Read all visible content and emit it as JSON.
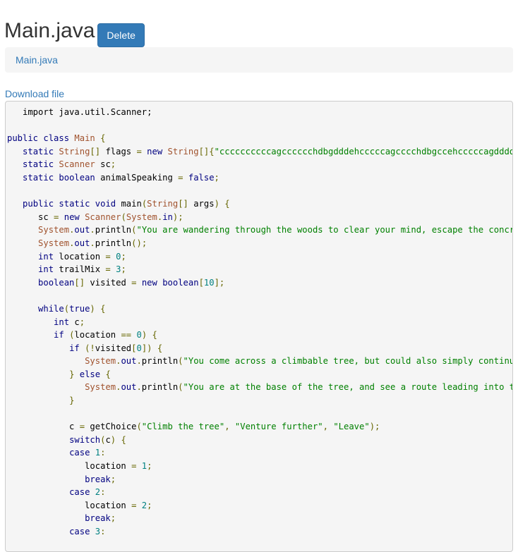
{
  "header": {
    "title": "Main.java",
    "delete_label": "Delete"
  },
  "breadcrumb": {
    "item": "Main.java"
  },
  "download": {
    "label": "Download file"
  },
  "code": {
    "lines": [
      [
        [
          "pl",
          "   import java.util.Scanner;"
        ]
      ],
      [],
      [
        [
          "kw",
          "public"
        ],
        [
          "pl",
          " "
        ],
        [
          "kw",
          "class"
        ],
        [
          "pl",
          " "
        ],
        [
          "ty",
          "Main"
        ],
        [
          "pl",
          " "
        ],
        [
          "op",
          "{"
        ]
      ],
      [
        [
          "pl",
          "   "
        ],
        [
          "kw",
          "static"
        ],
        [
          "pl",
          " "
        ],
        [
          "ty",
          "String"
        ],
        [
          "op",
          "[]"
        ],
        [
          "pl",
          " flags "
        ],
        [
          "op",
          "="
        ],
        [
          "pl",
          " "
        ],
        [
          "kw",
          "new"
        ],
        [
          "pl",
          " "
        ],
        [
          "ty",
          "String"
        ],
        [
          "op",
          "[]{"
        ],
        [
          "str",
          "\"ccccccccccagcccccchdbgdddehcccccagcccchdbgccehcccccagddddhdddd"
        ]
      ],
      [
        [
          "pl",
          "   "
        ],
        [
          "kw",
          "static"
        ],
        [
          "pl",
          " "
        ],
        [
          "ty",
          "Scanner"
        ],
        [
          "pl",
          " sc"
        ],
        [
          "op",
          ";"
        ]
      ],
      [
        [
          "pl",
          "   "
        ],
        [
          "kw",
          "static"
        ],
        [
          "pl",
          " "
        ],
        [
          "kw",
          "boolean"
        ],
        [
          "pl",
          " animalSpeaking "
        ],
        [
          "op",
          "="
        ],
        [
          "pl",
          " "
        ],
        [
          "kw",
          "false"
        ],
        [
          "op",
          ";"
        ]
      ],
      [],
      [
        [
          "pl",
          "   "
        ],
        [
          "kw",
          "public"
        ],
        [
          "pl",
          " "
        ],
        [
          "kw",
          "static"
        ],
        [
          "pl",
          " "
        ],
        [
          "kw",
          "void"
        ],
        [
          "pl",
          " main"
        ],
        [
          "op",
          "("
        ],
        [
          "ty",
          "String"
        ],
        [
          "op",
          "[]"
        ],
        [
          "pl",
          " args"
        ],
        [
          "op",
          ")"
        ],
        [
          "pl",
          " "
        ],
        [
          "op",
          "{"
        ]
      ],
      [
        [
          "pl",
          "      sc "
        ],
        [
          "op",
          "="
        ],
        [
          "pl",
          " "
        ],
        [
          "kw",
          "new"
        ],
        [
          "pl",
          " "
        ],
        [
          "ty",
          "Scanner"
        ],
        [
          "op",
          "("
        ],
        [
          "ty",
          "System"
        ],
        [
          "op",
          "."
        ],
        [
          "kw",
          "in"
        ],
        [
          "op",
          ");"
        ]
      ],
      [
        [
          "pl",
          "      "
        ],
        [
          "ty",
          "System"
        ],
        [
          "op",
          "."
        ],
        [
          "kw",
          "out"
        ],
        [
          "op",
          "."
        ],
        [
          "pl",
          "println"
        ],
        [
          "op",
          "("
        ],
        [
          "str",
          "\"You are wandering through the woods to clear your mind, escape the concrete"
        ]
      ],
      [
        [
          "pl",
          "      "
        ],
        [
          "ty",
          "System"
        ],
        [
          "op",
          "."
        ],
        [
          "kw",
          "out"
        ],
        [
          "op",
          "."
        ],
        [
          "pl",
          "println"
        ],
        [
          "op",
          "();"
        ]
      ],
      [
        [
          "pl",
          "      "
        ],
        [
          "kw",
          "int"
        ],
        [
          "pl",
          " location "
        ],
        [
          "op",
          "="
        ],
        [
          "pl",
          " "
        ],
        [
          "num",
          "0"
        ],
        [
          "op",
          ";"
        ]
      ],
      [
        [
          "pl",
          "      "
        ],
        [
          "kw",
          "int"
        ],
        [
          "pl",
          " trailMix "
        ],
        [
          "op",
          "="
        ],
        [
          "pl",
          " "
        ],
        [
          "num",
          "3"
        ],
        [
          "op",
          ";"
        ]
      ],
      [
        [
          "pl",
          "      "
        ],
        [
          "kw",
          "boolean"
        ],
        [
          "op",
          "[]"
        ],
        [
          "pl",
          " visited "
        ],
        [
          "op",
          "="
        ],
        [
          "pl",
          " "
        ],
        [
          "kw",
          "new"
        ],
        [
          "pl",
          " "
        ],
        [
          "kw",
          "boolean"
        ],
        [
          "op",
          "["
        ],
        [
          "num",
          "10"
        ],
        [
          "op",
          "];"
        ]
      ],
      [],
      [
        [
          "pl",
          "      "
        ],
        [
          "kw",
          "while"
        ],
        [
          "op",
          "("
        ],
        [
          "kw",
          "true"
        ],
        [
          "op",
          ")"
        ],
        [
          "pl",
          " "
        ],
        [
          "op",
          "{"
        ]
      ],
      [
        [
          "pl",
          "         "
        ],
        [
          "kw",
          "int"
        ],
        [
          "pl",
          " c"
        ],
        [
          "op",
          ";"
        ]
      ],
      [
        [
          "pl",
          "         "
        ],
        [
          "kw",
          "if"
        ],
        [
          "pl",
          " "
        ],
        [
          "op",
          "("
        ],
        [
          "pl",
          "location "
        ],
        [
          "op",
          "=="
        ],
        [
          "pl",
          " "
        ],
        [
          "num",
          "0"
        ],
        [
          "op",
          ")"
        ],
        [
          "pl",
          " "
        ],
        [
          "op",
          "{"
        ]
      ],
      [
        [
          "pl",
          "            "
        ],
        [
          "kw",
          "if"
        ],
        [
          "pl",
          " "
        ],
        [
          "op",
          "(!"
        ],
        [
          "pl",
          "visited"
        ],
        [
          "op",
          "["
        ],
        [
          "num",
          "0"
        ],
        [
          "op",
          "])"
        ],
        [
          "pl",
          " "
        ],
        [
          "op",
          "{"
        ]
      ],
      [
        [
          "pl",
          "               "
        ],
        [
          "ty",
          "System"
        ],
        [
          "op",
          "."
        ],
        [
          "kw",
          "out"
        ],
        [
          "op",
          "."
        ],
        [
          "pl",
          "println"
        ],
        [
          "op",
          "("
        ],
        [
          "str",
          "\"You come across a climbable tree, but could also simply continue f"
        ]
      ],
      [
        [
          "pl",
          "            "
        ],
        [
          "op",
          "}"
        ],
        [
          "pl",
          " "
        ],
        [
          "kw",
          "else"
        ],
        [
          "pl",
          " "
        ],
        [
          "op",
          "{"
        ]
      ],
      [
        [
          "pl",
          "               "
        ],
        [
          "ty",
          "System"
        ],
        [
          "op",
          "."
        ],
        [
          "kw",
          "out"
        ],
        [
          "op",
          "."
        ],
        [
          "pl",
          "println"
        ],
        [
          "op",
          "("
        ],
        [
          "str",
          "\"You are at the base of the tree, and see a route leading into the"
        ]
      ],
      [
        [
          "pl",
          "            "
        ],
        [
          "op",
          "}"
        ]
      ],
      [],
      [
        [
          "pl",
          "            c "
        ],
        [
          "op",
          "="
        ],
        [
          "pl",
          " getChoice"
        ],
        [
          "op",
          "("
        ],
        [
          "str",
          "\"Climb the tree\""
        ],
        [
          "op",
          ","
        ],
        [
          "pl",
          " "
        ],
        [
          "str",
          "\"Venture further\""
        ],
        [
          "op",
          ","
        ],
        [
          "pl",
          " "
        ],
        [
          "str",
          "\"Leave\""
        ],
        [
          "op",
          ");"
        ]
      ],
      [
        [
          "pl",
          "            "
        ],
        [
          "kw",
          "switch"
        ],
        [
          "op",
          "("
        ],
        [
          "pl",
          "c"
        ],
        [
          "op",
          ")"
        ],
        [
          "pl",
          " "
        ],
        [
          "op",
          "{"
        ]
      ],
      [
        [
          "pl",
          "            "
        ],
        [
          "kw",
          "case"
        ],
        [
          "pl",
          " "
        ],
        [
          "num",
          "1"
        ],
        [
          "op",
          ":"
        ]
      ],
      [
        [
          "pl",
          "               location "
        ],
        [
          "op",
          "="
        ],
        [
          "pl",
          " "
        ],
        [
          "num",
          "1"
        ],
        [
          "op",
          ";"
        ]
      ],
      [
        [
          "pl",
          "               "
        ],
        [
          "kw",
          "break"
        ],
        [
          "op",
          ";"
        ]
      ],
      [
        [
          "pl",
          "            "
        ],
        [
          "kw",
          "case"
        ],
        [
          "pl",
          " "
        ],
        [
          "num",
          "2"
        ],
        [
          "op",
          ":"
        ]
      ],
      [
        [
          "pl",
          "               location "
        ],
        [
          "op",
          "="
        ],
        [
          "pl",
          " "
        ],
        [
          "num",
          "2"
        ],
        [
          "op",
          ";"
        ]
      ],
      [
        [
          "pl",
          "               "
        ],
        [
          "kw",
          "break"
        ],
        [
          "op",
          ";"
        ]
      ],
      [
        [
          "pl",
          "            "
        ],
        [
          "kw",
          "case"
        ],
        [
          "pl",
          " "
        ],
        [
          "num",
          "3"
        ],
        [
          "op",
          ":"
        ]
      ]
    ]
  }
}
